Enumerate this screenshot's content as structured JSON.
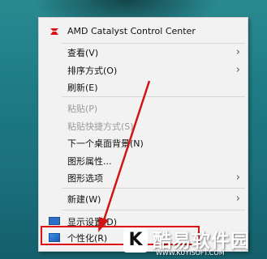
{
  "menu": {
    "amd": "AMD Catalyst Control Center",
    "view": "查看(V)",
    "sort": "排序方式(O)",
    "refresh": "刷新(E)",
    "paste": "粘贴(P)",
    "paste_shortcut": "粘贴快捷方式(S)",
    "next_bg": "下一个桌面背景(N)",
    "gfx_props": "图形属性...",
    "gfx_options": "图形选项",
    "new": "新建(W)",
    "display": "显示设置(D)",
    "personalize": "个性化(R)"
  },
  "watermark": {
    "badge": "K",
    "title": "酷易软件园",
    "url": "WWW.KUYISOFT.COM"
  },
  "colors": {
    "highlight": "#e01010",
    "arrow": "#d01515"
  }
}
